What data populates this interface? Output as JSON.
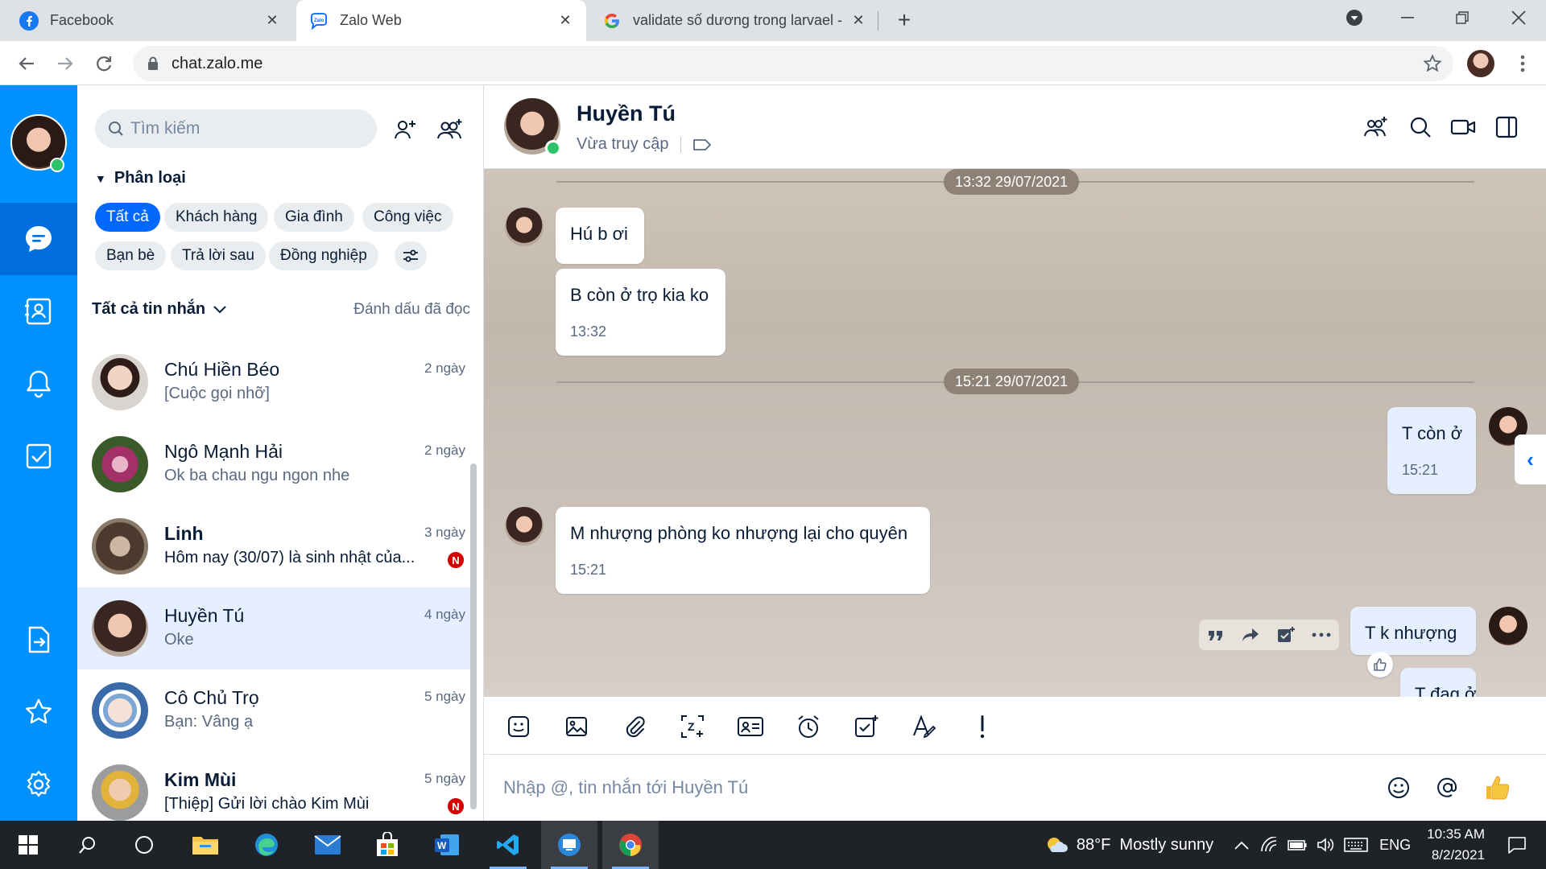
{
  "browser": {
    "tabs": [
      {
        "title": "Facebook",
        "icon": "facebook-icon"
      },
      {
        "title": "Zalo Web",
        "icon": "zalo-icon"
      },
      {
        "title": "validate số dương trong larvael -",
        "icon": "google-icon"
      }
    ],
    "url": "chat.zalo.me"
  },
  "conversations_panel": {
    "search_placeholder": "Tìm kiếm",
    "category_title": "Phân loại",
    "chips": [
      "Tất cả",
      "Khách hàng",
      "Gia đình",
      "Công việc",
      "Bạn bè",
      "Trả lời sau",
      "Đồng nghiệp"
    ],
    "filter_label": "Tất cả tin nhắn",
    "mark_read": "Đánh dấu đã đọc",
    "items": [
      {
        "name": "Chú Hiền Béo",
        "preview": "[Cuộc gọi nhỡ]",
        "time": "2 ngày",
        "badge": ""
      },
      {
        "name": "Ngô Mạnh Hải",
        "preview": "Ok ba chau ngu ngon nhe",
        "time": "2 ngày",
        "badge": ""
      },
      {
        "name": "Linh",
        "preview": "Hôm nay (30/07) là sinh nhật của...",
        "time": "3 ngày",
        "badge": "N"
      },
      {
        "name": "Huyền Tú",
        "preview": "Oke",
        "time": "4 ngày",
        "badge": ""
      },
      {
        "name": "Cô Chủ Trọ",
        "preview": "Bạn: Vâng ạ",
        "time": "5 ngày",
        "badge": ""
      },
      {
        "name": "Kim Mùi",
        "preview": "[Thiệp] Gửi lời chào Kim Mùi",
        "time": "5 ngày",
        "badge": "N"
      }
    ]
  },
  "chat": {
    "name": "Huyền Tú",
    "status": "Vừa truy cập",
    "date_separators": [
      "13:32 29/07/2021",
      "15:21 29/07/2021"
    ],
    "messages": [
      {
        "text": "Hú b ơi",
        "time": ""
      },
      {
        "text": "B còn ở trọ kia ko",
        "time": "13:32"
      },
      {
        "text": "T còn ở",
        "time": "15:21"
      },
      {
        "text": "M nhượng phòng ko nhượng lại cho quyên",
        "time": "15:21"
      },
      {
        "text": "T k nhượng",
        "time": ""
      },
      {
        "text": "T đag ở",
        "time": ""
      }
    ],
    "input_placeholder": "Nhập @, tin nhắn tới Huyền Tú"
  },
  "taskbar": {
    "weather": "88°F  Mostly sunny",
    "lang": "ENG",
    "time": "10:35 AM",
    "date": "8/2/2021"
  },
  "colors": {
    "zalo_blue": "#0091ff",
    "zalo_blue_active": "#006edc",
    "chip_active": "#0068ff",
    "selected_row": "#e5efff",
    "badge_red": "#d60000"
  }
}
